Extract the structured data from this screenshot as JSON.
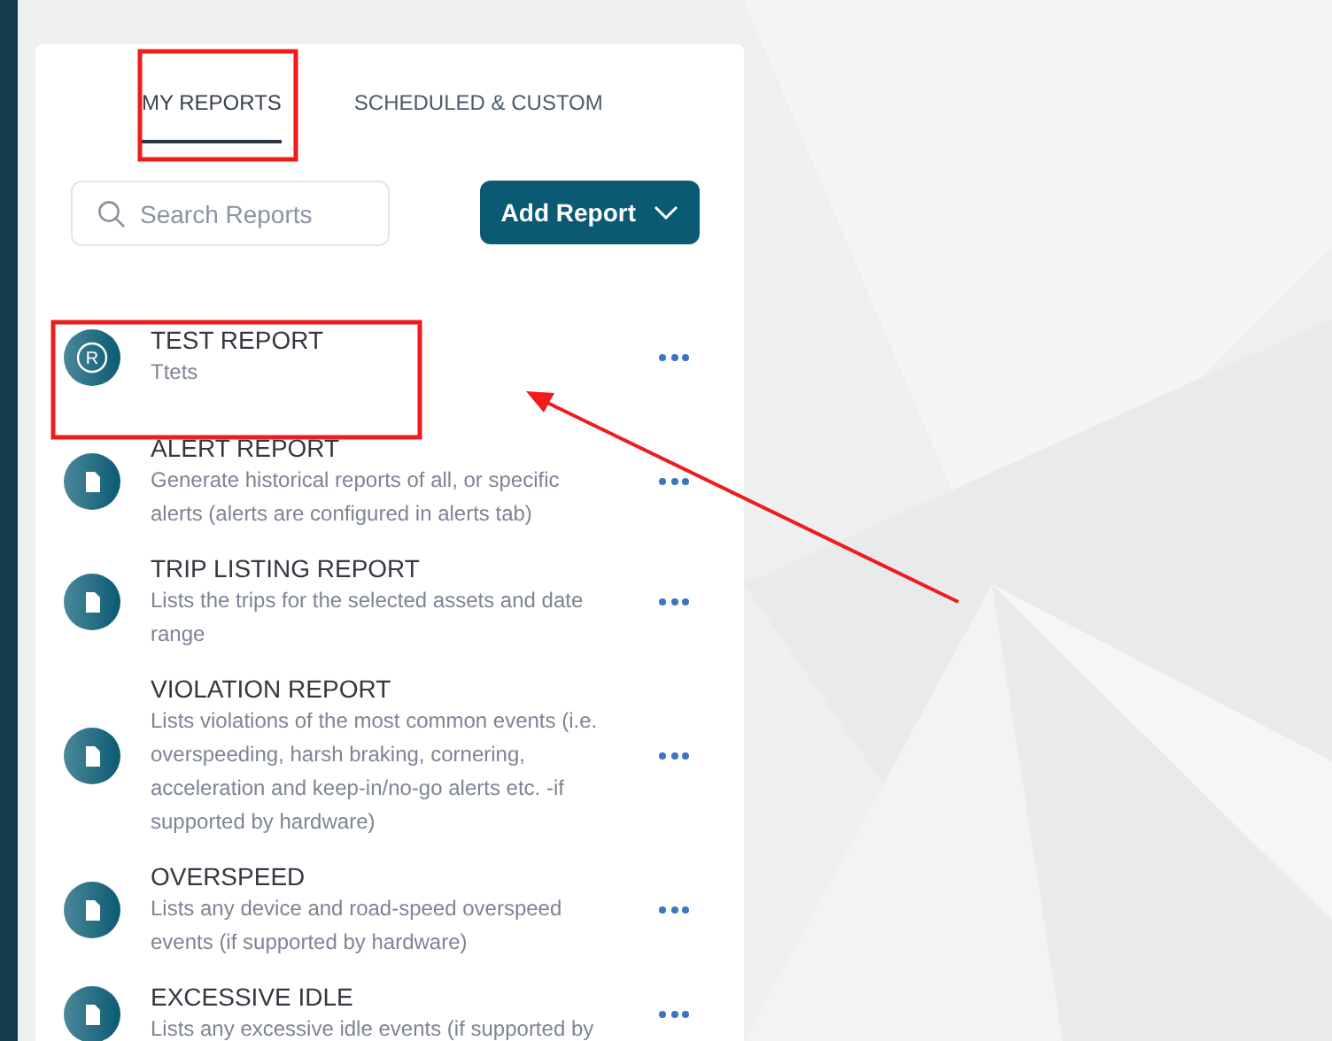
{
  "tabs": [
    {
      "label": "MY REPORTS",
      "selected": true
    },
    {
      "label": "SCHEDULED & CUSTOM",
      "selected": false
    }
  ],
  "search": {
    "placeholder": "Search Reports"
  },
  "add_button": {
    "label": "Add Report"
  },
  "reports": [
    {
      "kind": "custom",
      "badge": "R",
      "title": "TEST REPORT",
      "description": "Ttets"
    },
    {
      "kind": "standard",
      "title": "ALERT REPORT",
      "description": "Generate historical reports of all, or specific alerts (alerts are configured in alerts tab)"
    },
    {
      "kind": "standard",
      "title": "TRIP LISTING REPORT",
      "description": "Lists the trips for the selected assets and date range"
    },
    {
      "kind": "standard",
      "title": "VIOLATION REPORT",
      "description": "Lists violations of the most common events (i.e. overspeeding, harsh braking, cornering, acceleration and keep-in/no-go alerts etc. -if supported by hardware)"
    },
    {
      "kind": "standard",
      "title": "OVERSPEED",
      "description": "Lists any device and road-speed overspeed events (if supported by hardware)"
    },
    {
      "kind": "standard",
      "title": "EXCESSIVE IDLE",
      "description": "Lists any excessive idle events (if supported by"
    }
  ],
  "annotations": [
    {
      "kind": "box"
    },
    {
      "kind": "box"
    },
    {
      "kind": "arrow"
    }
  ]
}
